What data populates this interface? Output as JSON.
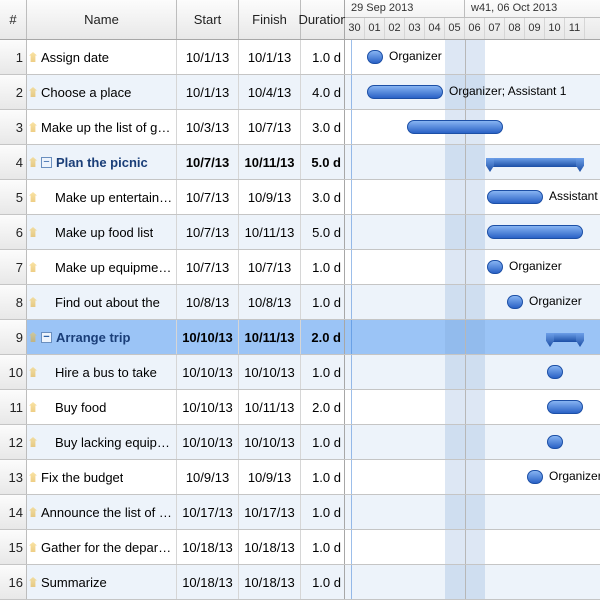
{
  "columns": {
    "num": "#",
    "name": "Name",
    "start": "Start",
    "finish": "Finish",
    "duration": "Duration"
  },
  "timeline": {
    "dayWidth": 20,
    "startOffset": 1,
    "weeks": [
      {
        "label": "29 Sep 2013",
        "span": 6
      },
      {
        "label": "w41, 06 Oct 2013",
        "span": 7
      }
    ],
    "days": [
      "30",
      "01",
      "02",
      "03",
      "04",
      "05",
      "06",
      "07",
      "08",
      "09",
      "10",
      "11"
    ],
    "weekendCols": [
      5,
      6
    ],
    "divider": 6,
    "currentLine": 0.3
  },
  "rows": [
    {
      "num": 1,
      "indent": 0,
      "name": "Assign date",
      "start": "10/1/13",
      "finish": "10/1/13",
      "dur": "1.0 d",
      "barStart": 1,
      "barEnd": 2,
      "label": "Organizer"
    },
    {
      "num": 2,
      "indent": 0,
      "name": "Choose a place",
      "start": "10/1/13",
      "finish": "10/4/13",
      "dur": "4.0 d",
      "barStart": 1,
      "barEnd": 5,
      "label": "Organizer; Assistant 1"
    },
    {
      "num": 3,
      "indent": 0,
      "name": "Make up the list of guests",
      "start": "10/3/13",
      "finish": "10/7/13",
      "dur": "3.0 d",
      "barStart": 3,
      "barEnd": 8
    },
    {
      "num": 4,
      "indent": 0,
      "group": true,
      "expanded": true,
      "bold": true,
      "name": "Plan the picnic",
      "start": "10/7/13",
      "finish": "10/11/13",
      "dur": "5.0 d",
      "barStart": 7,
      "barEnd": 12,
      "summary": true
    },
    {
      "num": 5,
      "indent": 1,
      "name": "Make up entertainment",
      "start": "10/7/13",
      "finish": "10/9/13",
      "dur": "3.0 d",
      "barStart": 7,
      "barEnd": 10,
      "label": "Assistant"
    },
    {
      "num": 6,
      "indent": 1,
      "name": "Make up food list",
      "start": "10/7/13",
      "finish": "10/11/13",
      "dur": "5.0 d",
      "barStart": 7,
      "barEnd": 12
    },
    {
      "num": 7,
      "indent": 1,
      "name": "Make up equipment list",
      "start": "10/7/13",
      "finish": "10/7/13",
      "dur": "1.0 d",
      "barStart": 7,
      "barEnd": 8,
      "label": "Organizer"
    },
    {
      "num": 8,
      "indent": 1,
      "name": "Find out about the",
      "start": "10/8/13",
      "finish": "10/8/13",
      "dur": "1.0 d",
      "barStart": 8,
      "barEnd": 9,
      "label": "Organizer"
    },
    {
      "num": 9,
      "indent": 0,
      "group": true,
      "expanded": true,
      "bold": true,
      "selected": true,
      "name": "Arrange trip",
      "start": "10/10/13",
      "finish": "10/11/13",
      "dur": "2.0 d",
      "barStart": 10,
      "barEnd": 12,
      "summary": true
    },
    {
      "num": 10,
      "indent": 1,
      "name": "Hire a bus to take",
      "start": "10/10/13",
      "finish": "10/10/13",
      "dur": "1.0 d",
      "barStart": 10,
      "barEnd": 11
    },
    {
      "num": 11,
      "indent": 1,
      "name": "Buy food",
      "start": "10/10/13",
      "finish": "10/11/13",
      "dur": "2.0 d",
      "barStart": 10,
      "barEnd": 12
    },
    {
      "num": 12,
      "indent": 1,
      "name": "Buy lacking equipment",
      "start": "10/10/13",
      "finish": "10/10/13",
      "dur": "1.0 d",
      "barStart": 10,
      "barEnd": 11
    },
    {
      "num": 13,
      "indent": 0,
      "name": "Fix the budget",
      "start": "10/9/13",
      "finish": "10/9/13",
      "dur": "1.0 d",
      "barStart": 9,
      "barEnd": 10,
      "label": "Organizer"
    },
    {
      "num": 14,
      "indent": 0,
      "name": "Announce the list of the",
      "start": "10/17/13",
      "finish": "10/17/13",
      "dur": "1.0 d"
    },
    {
      "num": 15,
      "indent": 0,
      "name": "Gather for the departure",
      "start": "10/18/13",
      "finish": "10/18/13",
      "dur": "1.0 d"
    },
    {
      "num": 16,
      "indent": 0,
      "name": "Summarize",
      "start": "10/18/13",
      "finish": "10/18/13",
      "dur": "1.0 d"
    }
  ]
}
